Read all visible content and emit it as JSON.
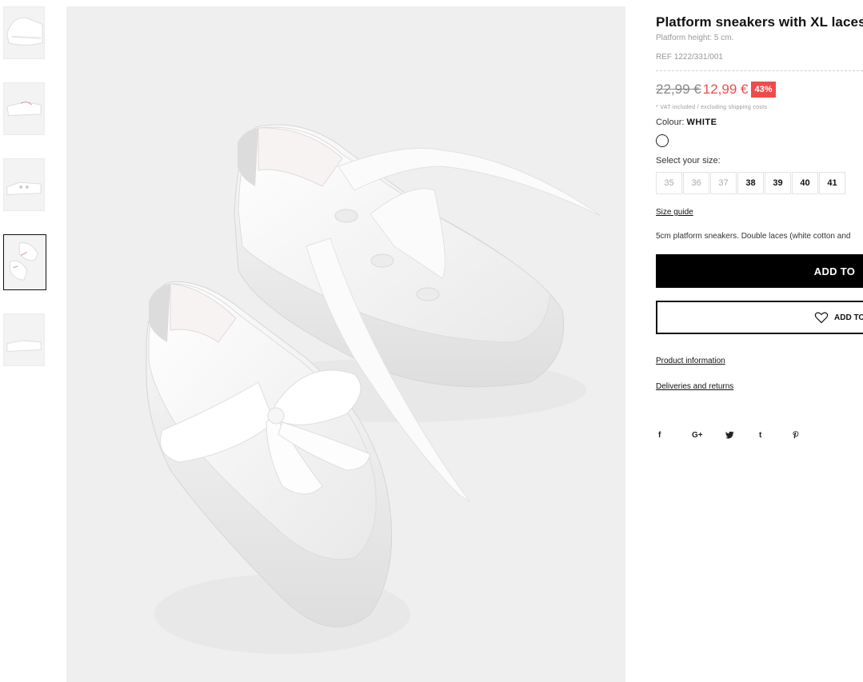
{
  "product": {
    "title": "Platform sneakers with XL laces",
    "subtitle": "Platform height: 5 cm.",
    "ref": "REF 1222/331/001",
    "old_price": "22,99 €",
    "new_price": "12,99 €",
    "discount": "43%",
    "vat_note": "* VAT included / excluding shipping costs",
    "colour_label": "Colour:",
    "colour_value": "WHITE",
    "size_label": "Select your size:",
    "sizes": [
      {
        "label": "35",
        "available": false
      },
      {
        "label": "36",
        "available": false
      },
      {
        "label": "37",
        "available": false
      },
      {
        "label": "38",
        "available": true
      },
      {
        "label": "39",
        "available": true
      },
      {
        "label": "40",
        "available": true
      },
      {
        "label": "41",
        "available": true
      }
    ],
    "size_guide": "Size guide",
    "description": "5cm platform sneakers. Double laces (white cotton and",
    "add_to_cart": "ADD TO",
    "add_to_wishlist": "ADD TO",
    "product_information": "Product information",
    "deliveries": "Deliveries and returns"
  },
  "social": {
    "facebook": "f",
    "google": "G+",
    "twitter": "🐦",
    "tumblr": "t",
    "pinterest": "𝓅"
  },
  "colors": {
    "sale": "#ee4c4c",
    "button_bg": "#000000",
    "image_bg": "#efefef"
  },
  "thumbnails": [
    {
      "icon": "sneaker-thumbnail-1",
      "active": false
    },
    {
      "icon": "sneaker-thumbnail-2",
      "active": false
    },
    {
      "icon": "sneaker-thumbnail-3",
      "active": false
    },
    {
      "icon": "sneaker-thumbnail-4",
      "active": true
    },
    {
      "icon": "sneaker-thumbnail-5",
      "active": false
    }
  ]
}
